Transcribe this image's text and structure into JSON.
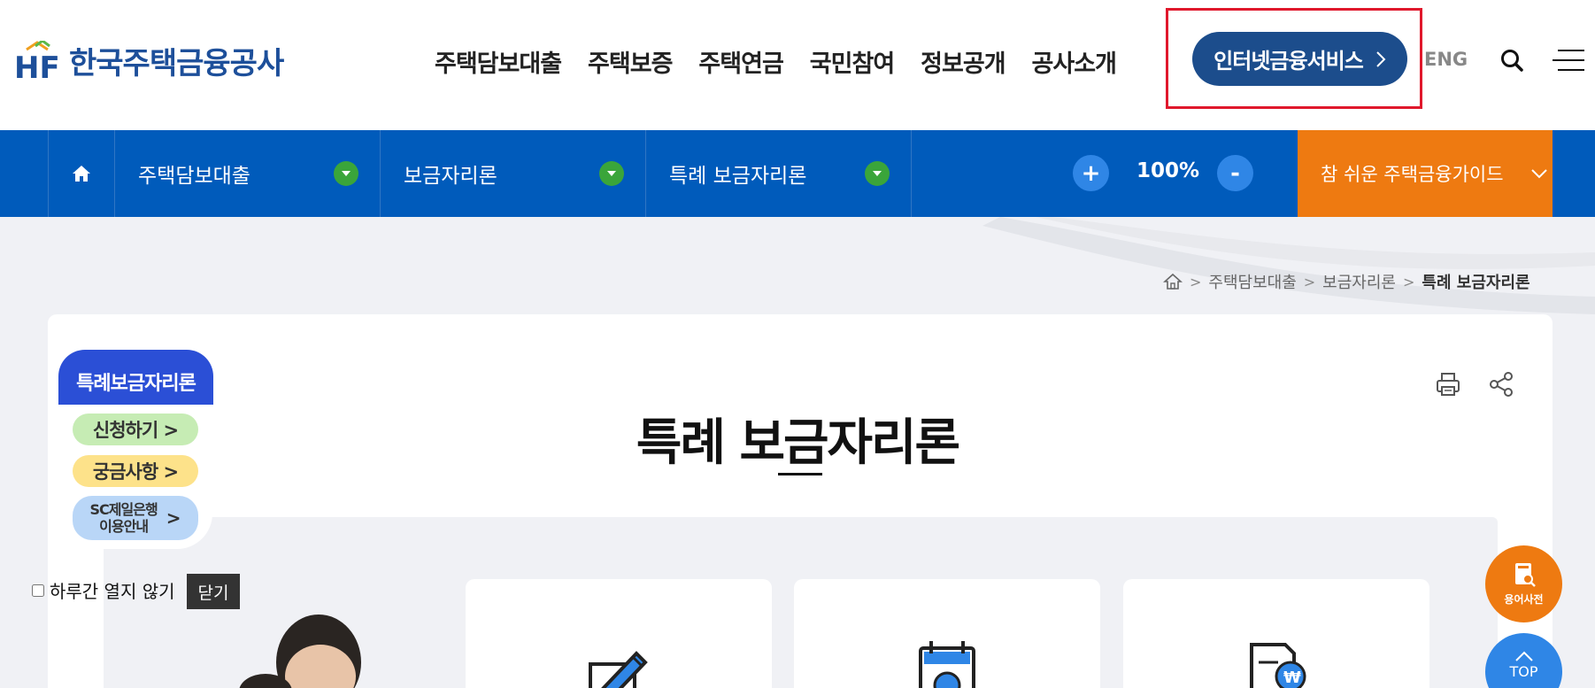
{
  "header": {
    "logo_text": "한국주택금융공사",
    "logo_mark": "HF",
    "nav_items": [
      "주택담보대출",
      "주택보증",
      "주택연금",
      "국민참여",
      "정보공개",
      "공사소개"
    ],
    "internet_service_label": "인터넷금융서비스",
    "eng_label": "ENG",
    "icons": {
      "search": "search-icon",
      "menu": "hamburger-menu-icon"
    }
  },
  "subnav": {
    "dropdowns": [
      "주택담보대출",
      "보금자리론",
      "특례 보금자리론"
    ],
    "zoom_plus": "+",
    "zoom_value": "100%",
    "zoom_minus": "-",
    "guide_label": "참 쉬운 주택금융가이드"
  },
  "breadcrumb": {
    "items": [
      "주택담보대출",
      "보금자리론"
    ],
    "current": "특례 보금자리론"
  },
  "main": {
    "title": "특례 보금자리론"
  },
  "popup": {
    "title": "특례보금자리론",
    "apply": "신청하기 >",
    "faq": "궁금사항 >",
    "sc_line1": "SC제일은행",
    "sc_line2": "이용안내",
    "sc_arrow": ">",
    "dont_show_today": "하루간 열지 않기",
    "close": "닫기"
  },
  "floating": {
    "dictionary": "용어사전",
    "top": "TOP"
  },
  "colors": {
    "brand_blue": "#005bbb",
    "navy_button": "#1c4d8c",
    "orange": "#ee7a11",
    "green_circle": "#3aa53a",
    "highlight_red": "#e0182c"
  }
}
